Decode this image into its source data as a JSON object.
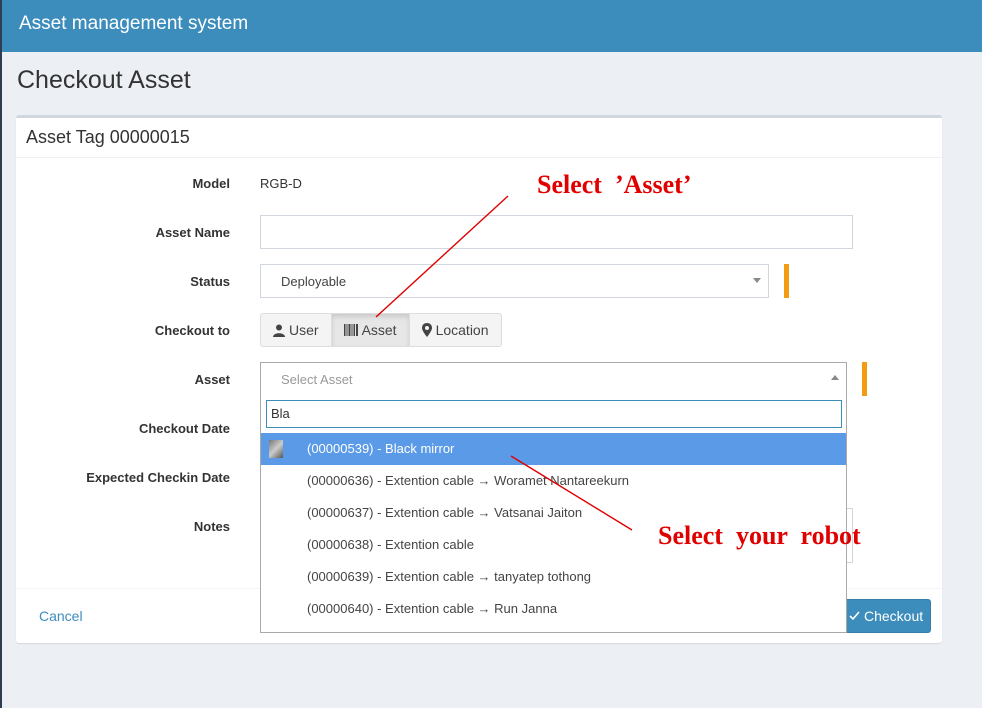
{
  "app": {
    "title": "Asset management system"
  },
  "page": {
    "title": "Checkout Asset"
  },
  "box": {
    "title": "Asset Tag 00000015"
  },
  "form": {
    "model_label": "Model",
    "model_value": "RGB-D",
    "asset_name_label": "Asset Name",
    "asset_name_value": "",
    "status_label": "Status",
    "status_value": "Deployable",
    "checkout_to_label": "Checkout to",
    "checkout_to_options": [
      {
        "label": "User",
        "icon": "user-icon",
        "active": false
      },
      {
        "label": "Asset",
        "icon": "barcode-icon",
        "active": true
      },
      {
        "label": "Location",
        "icon": "map-marker-icon",
        "active": false
      }
    ],
    "asset_label": "Asset",
    "asset_placeholder": "Select Asset",
    "checkout_date_label": "Checkout Date",
    "expected_checkin_label": "Expected Checkin Date",
    "notes_label": "Notes"
  },
  "dropdown": {
    "search_value": "Bla",
    "items": [
      {
        "text": "(00000539) - Black mirror",
        "highlighted": true,
        "has_thumb": true
      },
      {
        "text": "(00000636) - Extention cable → Woramet Nantareekurn",
        "highlighted": false,
        "has_thumb": false
      },
      {
        "text": "(00000637) - Extention cable → Vatsanai Jaiton",
        "highlighted": false,
        "has_thumb": false
      },
      {
        "text": "(00000638) - Extention cable",
        "highlighted": false,
        "has_thumb": false
      },
      {
        "text": "(00000639) - Extention cable → tanyatep tothong",
        "highlighted": false,
        "has_thumb": false
      },
      {
        "text": "(00000640) - Extention cable → Run Janna",
        "highlighted": false,
        "has_thumb": false
      }
    ]
  },
  "footer": {
    "cancel_label": "Cancel",
    "checkout_label": "Checkout"
  },
  "annotations": {
    "select_asset": "Select  ’Asset’",
    "select_robot": "Select  your  robot"
  },
  "colors": {
    "topbar": "#3c8dbc",
    "required_marker": "#f39c12",
    "highlight": "#5b9ae6",
    "annotation": "#e00000"
  }
}
